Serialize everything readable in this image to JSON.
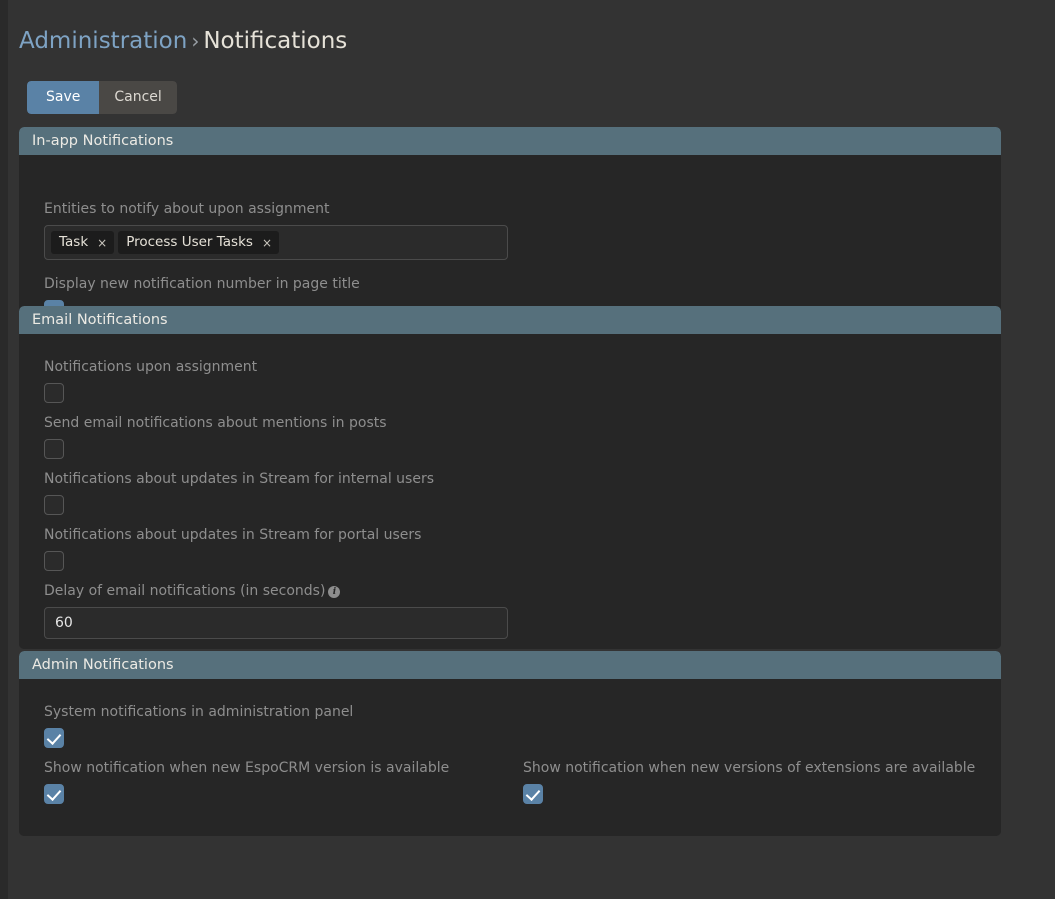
{
  "breadcrumb": {
    "parent": "Administration",
    "separator": "›",
    "current": "Notifications"
  },
  "toolbar": {
    "save_label": "Save",
    "cancel_label": "Cancel"
  },
  "panels": {
    "inapp": {
      "title": "In-app Notifications",
      "entities_label": "Entities to notify about upon assignment",
      "tags": [
        {
          "label": "Task",
          "remove": "×"
        },
        {
          "label": "Process User Tasks",
          "remove": "×"
        }
      ],
      "display_number_label": "Display new notification number in page title",
      "display_number_checked": "checked"
    },
    "email": {
      "title": "Email Notifications",
      "assignment_label": "Notifications upon assignment",
      "assignment_checked": "unchecked",
      "mentions_label": "Send email notifications about mentions in posts",
      "mentions_checked": "unchecked",
      "stream_internal_label": "Notifications about updates in Stream for internal users",
      "stream_internal_checked": "unchecked",
      "stream_portal_label": "Notifications about updates in Stream for portal users",
      "stream_portal_checked": "unchecked",
      "delay_label": "Delay of email notifications (in seconds)",
      "delay_info_icon": "info-icon",
      "delay_value": "60",
      "delay_placeholder": ""
    },
    "admin": {
      "title": "Admin Notifications",
      "system_label": "System notifications in administration panel",
      "system_checked": "checked",
      "new_version_label": "Show notification when new EspoCRM version is available",
      "new_version_checked": "checked",
      "extensions_label": "Show notification when new versions of extensions are available",
      "extensions_checked": "checked"
    }
  },
  "colors": {
    "page_background": "#333333",
    "panel_background": "#262626",
    "panel_header": "#56707c",
    "accent": "#5a82a6",
    "link": "#7ea3c4",
    "label_text": "#8e8e8e"
  }
}
